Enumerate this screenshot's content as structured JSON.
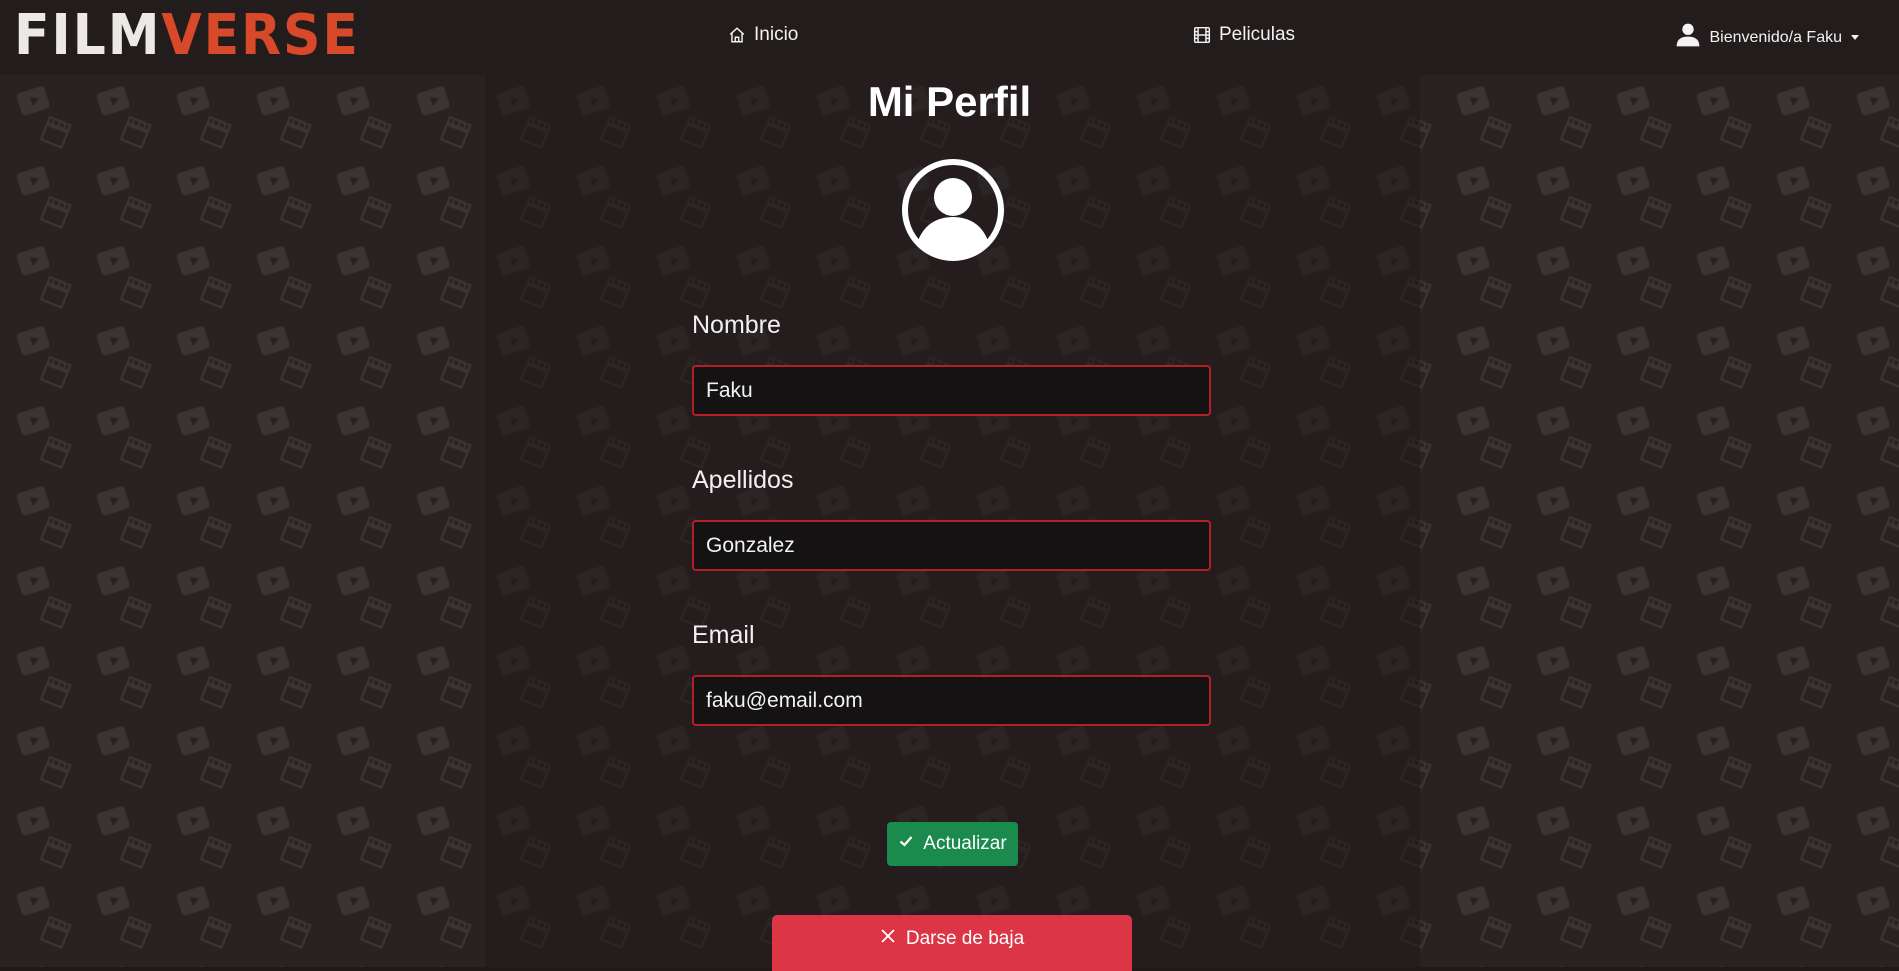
{
  "brand": {
    "part1": "FILM",
    "part2": "VERSE"
  },
  "nav": {
    "home": {
      "label": "Inicio",
      "icon": "house-icon"
    },
    "movies": {
      "label": "Peliculas",
      "icon": "film-icon"
    },
    "user": {
      "label": "Bienvenido/a Faku",
      "icon": "user-icon"
    }
  },
  "profile": {
    "title": "Mi Perfil",
    "avatar_icon": "user-circle-icon",
    "fields": [
      {
        "label": "Nombre",
        "value": "Faku"
      },
      {
        "label": "Apellidos",
        "value": "Gonzalez"
      },
      {
        "label": "Email",
        "value": "faku@email.com"
      }
    ],
    "update_button": {
      "label": "Actualizar",
      "icon": "check-icon"
    },
    "delete_button": {
      "label": "Darse de baja",
      "icon": "x-icon"
    }
  },
  "colors": {
    "brand_accent": "#d8492a",
    "input_border": "#b51e26",
    "update": "#1a8b4c",
    "delete": "#dc3545"
  }
}
